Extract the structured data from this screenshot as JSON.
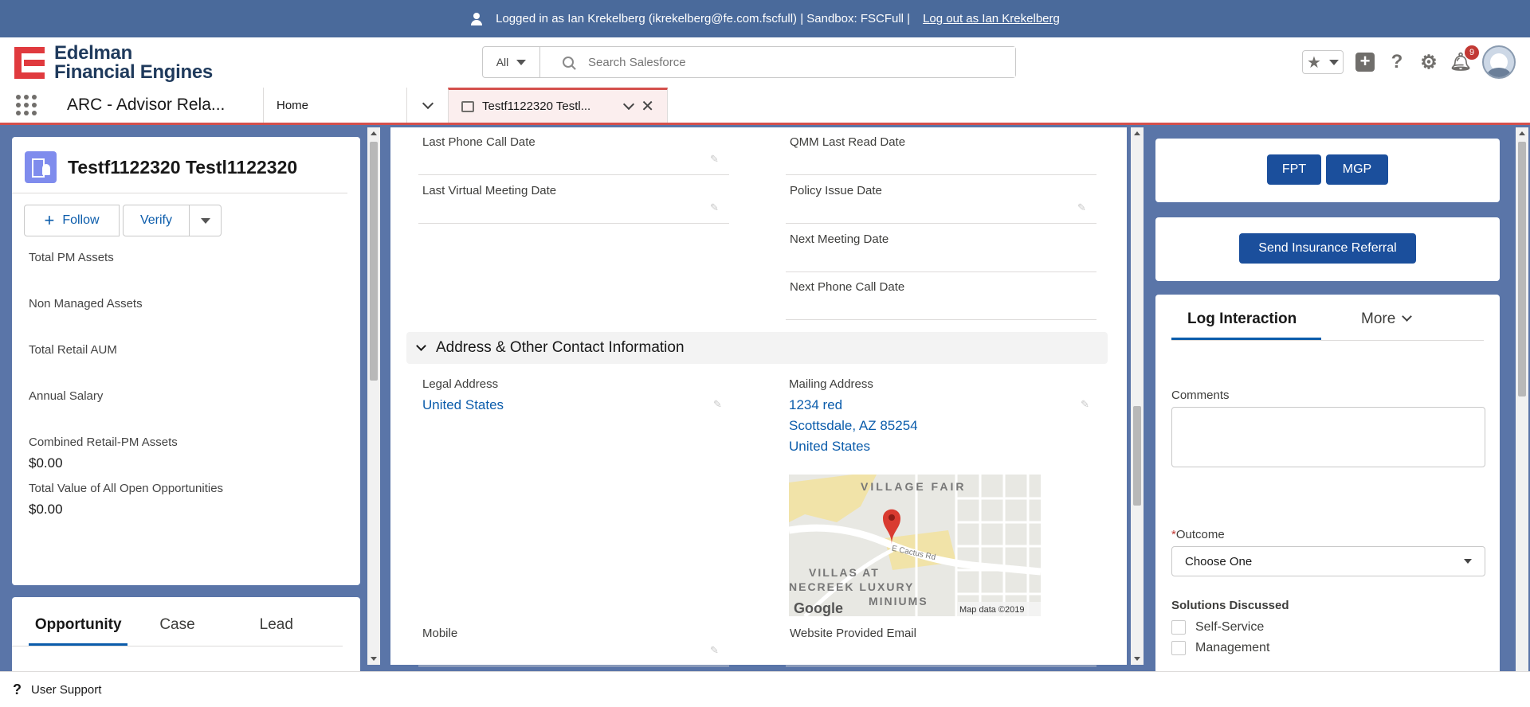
{
  "banner": {
    "text": "Logged in as Ian Krekelberg (ikrekelberg@fe.com.fscfull) | Sandbox: FSCFull |",
    "logout_label": "Log out as Ian Krekelberg"
  },
  "header": {
    "logo_line1": "Edelman",
    "logo_line2": "Financial Engines",
    "search_scope": "All",
    "search_placeholder": "Search Salesforce",
    "notification_count": "9"
  },
  "nav": {
    "app_name": "ARC - Advisor Rela...",
    "home_tab": "Home",
    "active_tab": "Testf1122320 Testl..."
  },
  "record": {
    "title": "Testf1122320 Testl1122320",
    "follow_label": "Follow",
    "verify_label": "Verify",
    "fields": [
      {
        "label": "Total PM Assets",
        "value": ""
      },
      {
        "label": "Non Managed Assets",
        "value": ""
      },
      {
        "label": "Total Retail AUM",
        "value": ""
      },
      {
        "label": "Annual Salary",
        "value": ""
      },
      {
        "label": "Combined Retail-PM Assets",
        "value": "$0.00"
      },
      {
        "label": "Total Value of All Open Opportunities",
        "value": "$0.00"
      }
    ],
    "tabs": [
      "Opportunity",
      "Case",
      "Lead"
    ]
  },
  "details": {
    "fields": [
      {
        "label": "Last Phone Call Date"
      },
      {
        "label": "QMM Last Read Date"
      },
      {
        "label": "Last Virtual Meeting Date"
      },
      {
        "label": "Policy Issue Date"
      },
      {
        "label": "Next Meeting Date"
      },
      {
        "label": "Next Phone Call Date"
      },
      {
        "label": "Mobile"
      },
      {
        "label": "Website Provided Email"
      }
    ],
    "section_title": "Address & Other Contact Information",
    "legal_address_label": "Legal Address",
    "legal_address": "United States",
    "mailing_address_label": "Mailing Address",
    "mailing_line1": "1234 red",
    "mailing_line2": "Scottsdale, AZ 85254",
    "mailing_line3": "United States",
    "map": {
      "label_village": "VILLAGE FAIR",
      "label_street": "E Cactus Rd",
      "label_villas1": "VILLAS AT",
      "label_villas2": "NECREEK LUXURY",
      "label_villas3": "MINIUMS",
      "google": "Google",
      "attribution": "Map data ©2019"
    }
  },
  "right_panel": {
    "fpt_label": "FPT",
    "mgp_label": "MGP",
    "send_referral_label": "Send Insurance Referral",
    "tab_log": "Log Interaction",
    "tab_more": "More",
    "comments_label": "Comments",
    "outcome_label": "Outcome",
    "outcome_value": "Choose One",
    "solutions_label": "Solutions Discussed",
    "solutions": [
      "Self-Service",
      "Management"
    ]
  },
  "footer": {
    "label": "User Support"
  },
  "colors": {
    "banner": "#4a6a9b",
    "accent": "#0b5cab",
    "button_blue": "#1b4f9c",
    "tab_red": "#d4504c"
  }
}
